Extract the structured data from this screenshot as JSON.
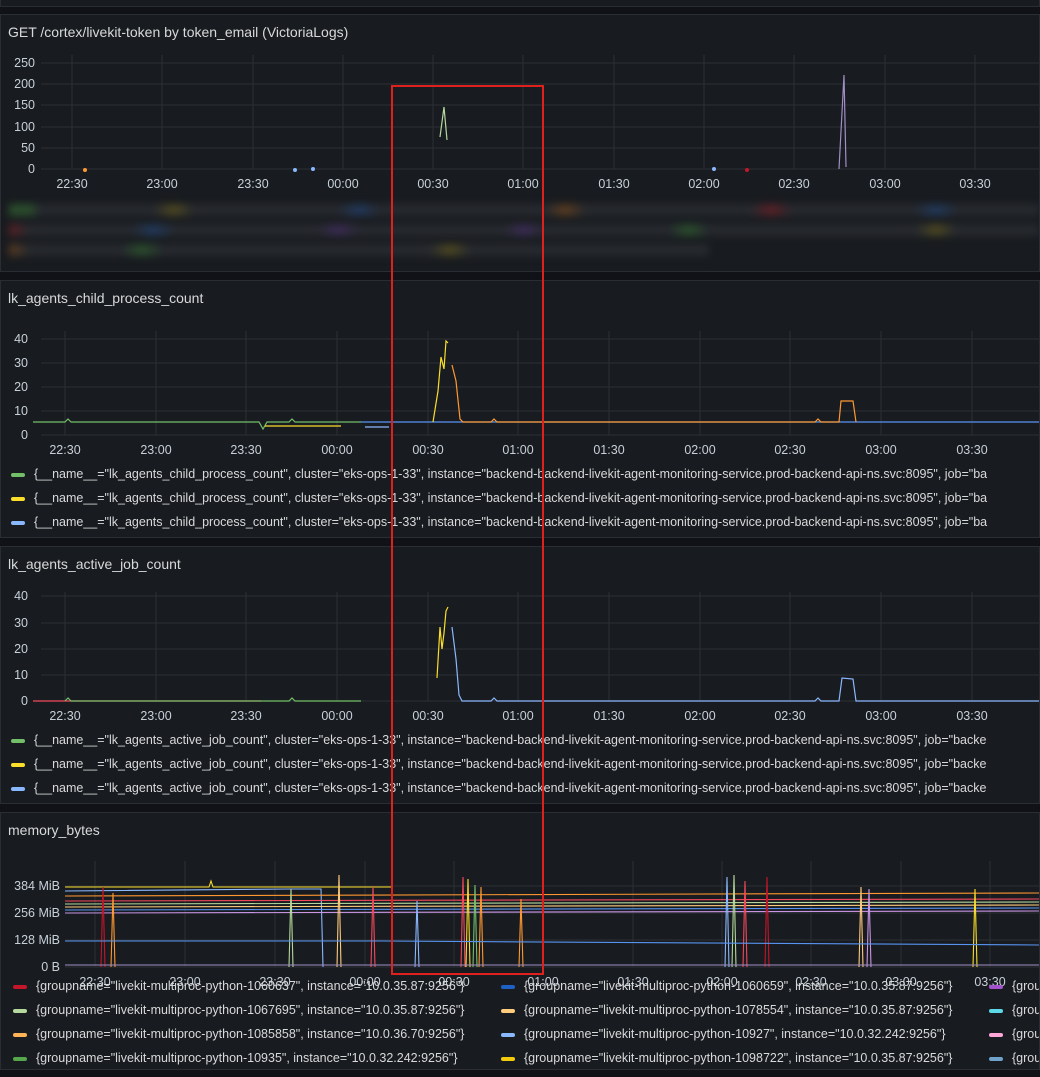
{
  "colors": {
    "green": "#73bf69",
    "yellow": "#fade2a",
    "blue": "#8ab8ff",
    "orange": "#ff9830",
    "purple": "#a08fc7",
    "red": "#f2495c",
    "highlight": "#e0201c"
  },
  "time_ticks": [
    "22:30",
    "23:00",
    "23:30",
    "00:00",
    "00:30",
    "01:00",
    "01:30",
    "02:00",
    "02:30",
    "03:00",
    "03:30"
  ],
  "panels": [
    {
      "title": "GET /cortex/livekit-token by token_email (VictoriaLogs)",
      "y_ticks": [
        "250",
        "200",
        "150",
        "100",
        "50",
        "0"
      ]
    },
    {
      "title": "lk_agents_child_process_count",
      "y_ticks": [
        "40",
        "30",
        "20",
        "10",
        "0"
      ],
      "legend": [
        "{__name__=\"lk_agents_child_process_count\", cluster=\"eks-ops-1-33\", instance=\"backend-backend-livekit-agent-monitoring-service.prod-backend-api-ns.svc:8095\", job=\"ba",
        "{__name__=\"lk_agents_child_process_count\", cluster=\"eks-ops-1-33\", instance=\"backend-backend-livekit-agent-monitoring-service.prod-backend-api-ns.svc:8095\", job=\"ba",
        "{__name__=\"lk_agents_child_process_count\", cluster=\"eks-ops-1-33\", instance=\"backend-backend-livekit-agent-monitoring-service.prod-backend-api-ns.svc:8095\", job=\"ba"
      ]
    },
    {
      "title": "lk_agents_active_job_count",
      "y_ticks": [
        "40",
        "30",
        "20",
        "10",
        "0"
      ],
      "legend": [
        "{__name__=\"lk_agents_active_job_count\", cluster=\"eks-ops-1-33\", instance=\"backend-backend-livekit-agent-monitoring-service.prod-backend-api-ns.svc:8095\", job=\"backe",
        "{__name__=\"lk_agents_active_job_count\", cluster=\"eks-ops-1-33\", instance=\"backend-backend-livekit-agent-monitoring-service.prod-backend-api-ns.svc:8095\", job=\"backe",
        "{__name__=\"lk_agents_active_job_count\", cluster=\"eks-ops-1-33\", instance=\"backend-backend-livekit-agent-monitoring-service.prod-backend-api-ns.svc:8095\", job=\"backe"
      ]
    },
    {
      "title": "memory_bytes",
      "y_ticks": [
        "384 MiB",
        "256 MiB",
        "128 MiB",
        "0 B"
      ],
      "legend_rows": [
        [
          "{groupname=\"livekit-multiproc-python-1060637\", instance=\"10.0.35.87:9256\"}",
          "{groupname=\"livekit-multiproc-python-1060659\", instance=\"10.0.35.87:9256\"}",
          "{grou"
        ],
        [
          "{groupname=\"livekit-multiproc-python-1067695\", instance=\"10.0.35.87:9256\"}",
          "{groupname=\"livekit-multiproc-python-1078554\", instance=\"10.0.35.87:9256\"}",
          "{grou"
        ],
        [
          "{groupname=\"livekit-multiproc-python-1085858\", instance=\"10.0.36.70:9256\"}",
          "{groupname=\"livekit-multiproc-python-10927\", instance=\"10.0.32.242:9256\"}",
          "{grou"
        ],
        [
          "{groupname=\"livekit-multiproc-python-10935\", instance=\"10.0.32.242:9256\"}",
          "{groupname=\"livekit-multiproc-python-1098722\", instance=\"10.0.35.87:9256\"}",
          "{grou"
        ]
      ]
    }
  ]
}
